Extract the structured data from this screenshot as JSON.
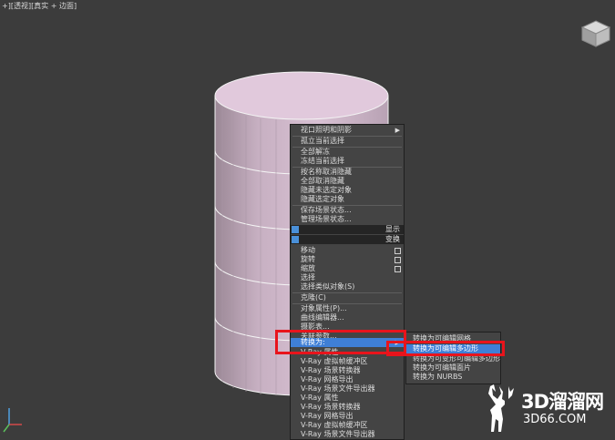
{
  "viewport": {
    "label": "+][透视][真实 + 边面]"
  },
  "quad_menu": {
    "items": [
      "视口照明和阴影",
      "孤立当前选择",
      "全部解冻",
      "冻结当前选择",
      "按名称取消隐藏",
      "全部取消隐藏",
      "隐藏未选定对象",
      "隐藏选定对象",
      "保存场景状态...",
      "管理场景状态..."
    ],
    "display_header": "显示",
    "transform_header": "变换",
    "transform_items": [
      "移动",
      "旋转",
      "缩放",
      "选择",
      "选择类似对象(S)",
      "克隆(C)",
      "对象属性(P)...",
      "曲线编辑器...",
      "摄影表...",
      "关联参数...",
      "转换为:",
      "V-Ray 属性",
      "V-Ray 虚拟帧缓冲区",
      "V-Ray 场景转换器",
      "V-Ray 网格导出",
      "V-Ray 场景文件导出器",
      "V-Ray 属性",
      "V-Ray 场景转换器",
      "V-Ray 网格导出",
      "V-Ray 虚拟帧缓冲区",
      "V-Ray 场景文件导出器"
    ]
  },
  "convert_submenu": {
    "items": [
      "转换为可编辑网格",
      "转换为可编辑多边形",
      "转换为可变形可编辑多边形",
      "转换为可编辑面片",
      "转换为 NURBS"
    ]
  },
  "watermark": {
    "title": "3D溜溜网",
    "url": "3D66.COM"
  },
  "colors": {
    "highlight": "#e8141c",
    "menu_active": "#3f7fd6",
    "cylinder": "#dcc3d6"
  }
}
